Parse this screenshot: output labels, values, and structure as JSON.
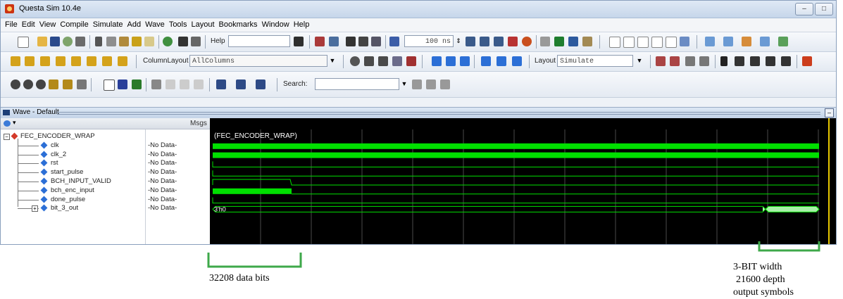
{
  "window": {
    "title": "Questa Sim 10.4e",
    "controls": [
      "–",
      "□"
    ]
  },
  "menu": [
    "File",
    "Edit",
    "View",
    "Compile",
    "Simulate",
    "Add",
    "Wave",
    "Tools",
    "Layout",
    "Bookmarks",
    "Window",
    "Help"
  ],
  "toolbar1": {
    "help_label": "Help",
    "help_value": "",
    "run_length": "100 ns"
  },
  "toolbar2": {
    "column_layout_label": "ColumnLayout",
    "column_layout_value": "AllColumns",
    "layout_label": "Layout",
    "layout_value": "Simulate"
  },
  "toolbar3": {
    "search_label": "Search:",
    "search_value": ""
  },
  "wave": {
    "pane_title": "Wave - Default",
    "msgs_header": "Msgs",
    "group_label": "(FEC_ENCODER_WRAP)",
    "signals": [
      {
        "name": "FEC_ENCODER_WRAP",
        "msg": "",
        "kind": "group"
      },
      {
        "name": "clk",
        "msg": "-No Data-",
        "kind": "clock"
      },
      {
        "name": "clk_2",
        "msg": "-No Data-",
        "kind": "clock"
      },
      {
        "name": "rst",
        "msg": "-No Data-",
        "kind": "low"
      },
      {
        "name": "start_pulse",
        "msg": "-No Data-",
        "kind": "low"
      },
      {
        "name": "BCH_INPUT_VALID",
        "msg": "-No Data-",
        "kind": "pulse"
      },
      {
        "name": "bch_enc_input",
        "msg": "-No Data-",
        "kind": "data"
      },
      {
        "name": "done_pulse",
        "msg": "-No Data-",
        "kind": "low"
      },
      {
        "name": "bit_3_out",
        "msg": "-No Data-",
        "kind": "bus",
        "bus_value": "3'h0"
      }
    ]
  },
  "annotations": {
    "input_label": "32208 data bits",
    "output_lines": [
      "3-BIT width",
      "21600 depth",
      "output symbols"
    ]
  },
  "colors": {
    "wave_green": "#00e000",
    "bracket_green": "#3ea84a",
    "cursor": "#e8c800",
    "bus_green": "#a8f0a8"
  }
}
